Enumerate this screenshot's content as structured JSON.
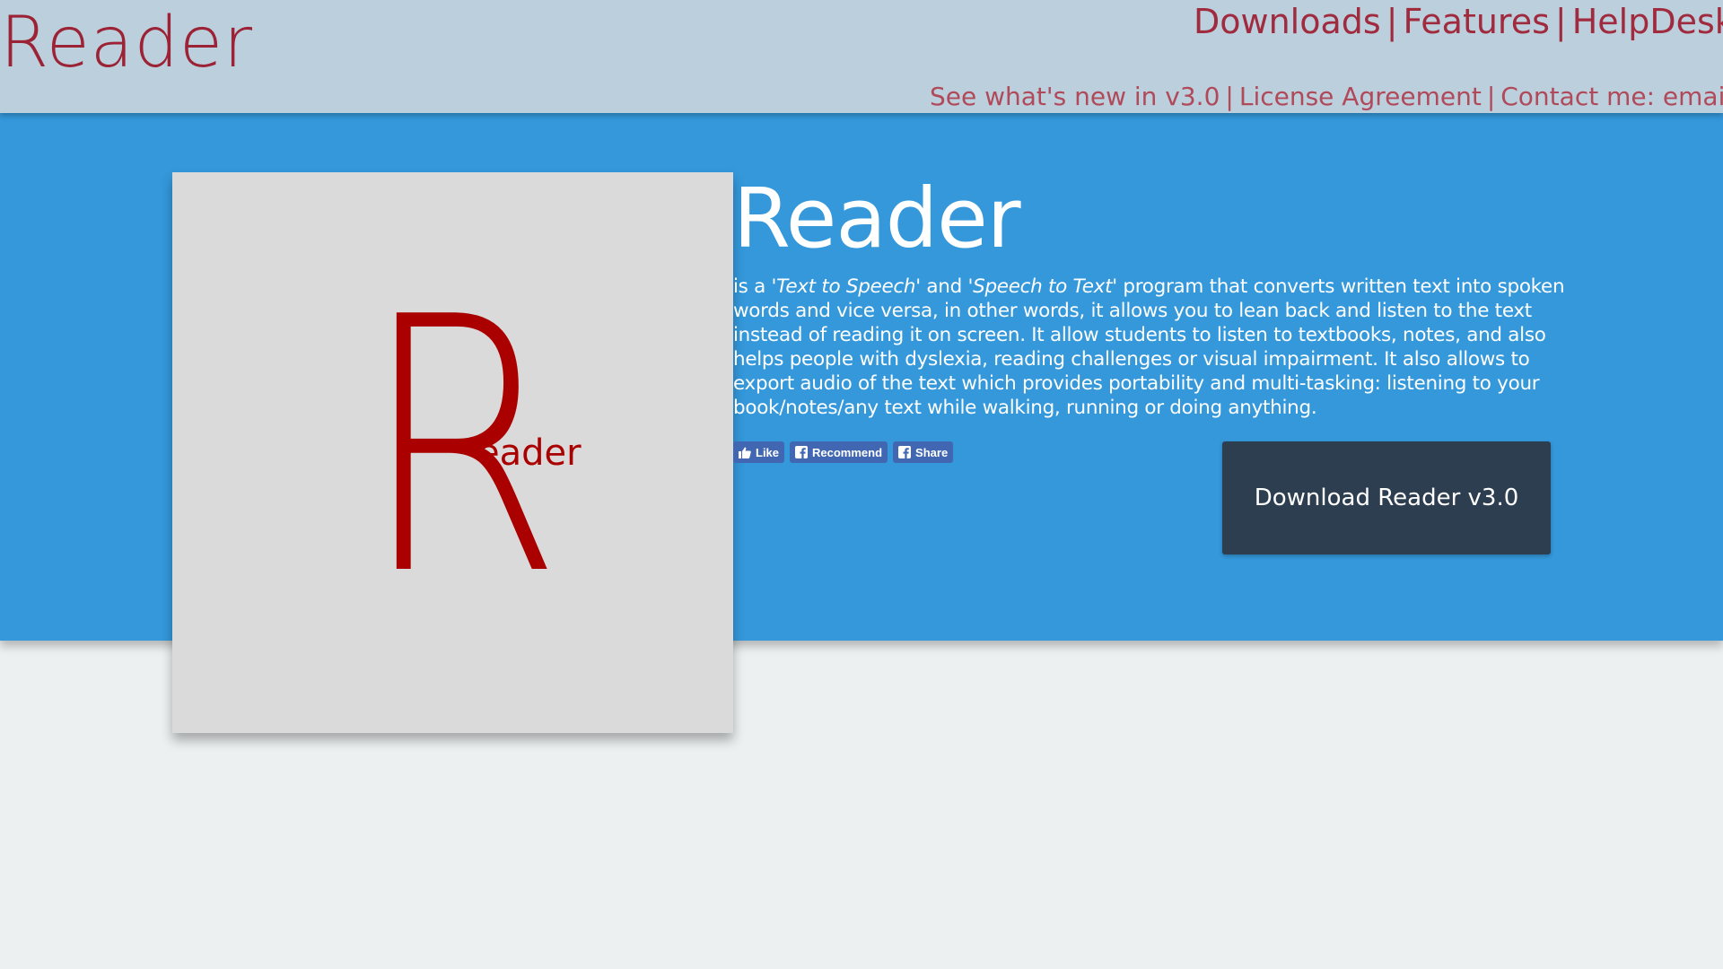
{
  "header": {
    "brand": "Reader",
    "nav_top": {
      "downloads": "Downloads",
      "features": "Features",
      "helpdesk": "HelpDesk",
      "separator": "|"
    },
    "nav_bottom": {
      "whats_new": "See what's new in v3.0",
      "license": "License Agreement",
      "contact": "Contact me: email@r",
      "separator": "|"
    }
  },
  "hero": {
    "logo": {
      "letter": "R",
      "word": "eader",
      "color": "#aa0000"
    },
    "title": "Reader",
    "description": {
      "part1": "is a ",
      "tts": "'Text to Speech'",
      "part2": " and ",
      "stt": "'Speech to Text'",
      "part3": " program that converts written text into spoken words and vice versa, in other words, it allows you to lean back and listen to the text instead of reading it on screen. It allow students to listen to textbooks, notes, and also helps people with dyslexia, reading challenges or visual impairment. It also allows to export audio of the text which provides portability and multi-tasking: listening to your book/notes/any text while walking, running or doing anything."
    },
    "social": {
      "like": "Like",
      "recommend": "Recommend",
      "share": "Share"
    },
    "download_button": "Download Reader v3.0"
  },
  "colors": {
    "header_bg": "#bccfdc",
    "brand": "#9b2335",
    "hero_bg": "#3498db",
    "button_bg": "#2c3e50",
    "page_bg": "#ecf0f1",
    "facebook": "#4267b2"
  }
}
